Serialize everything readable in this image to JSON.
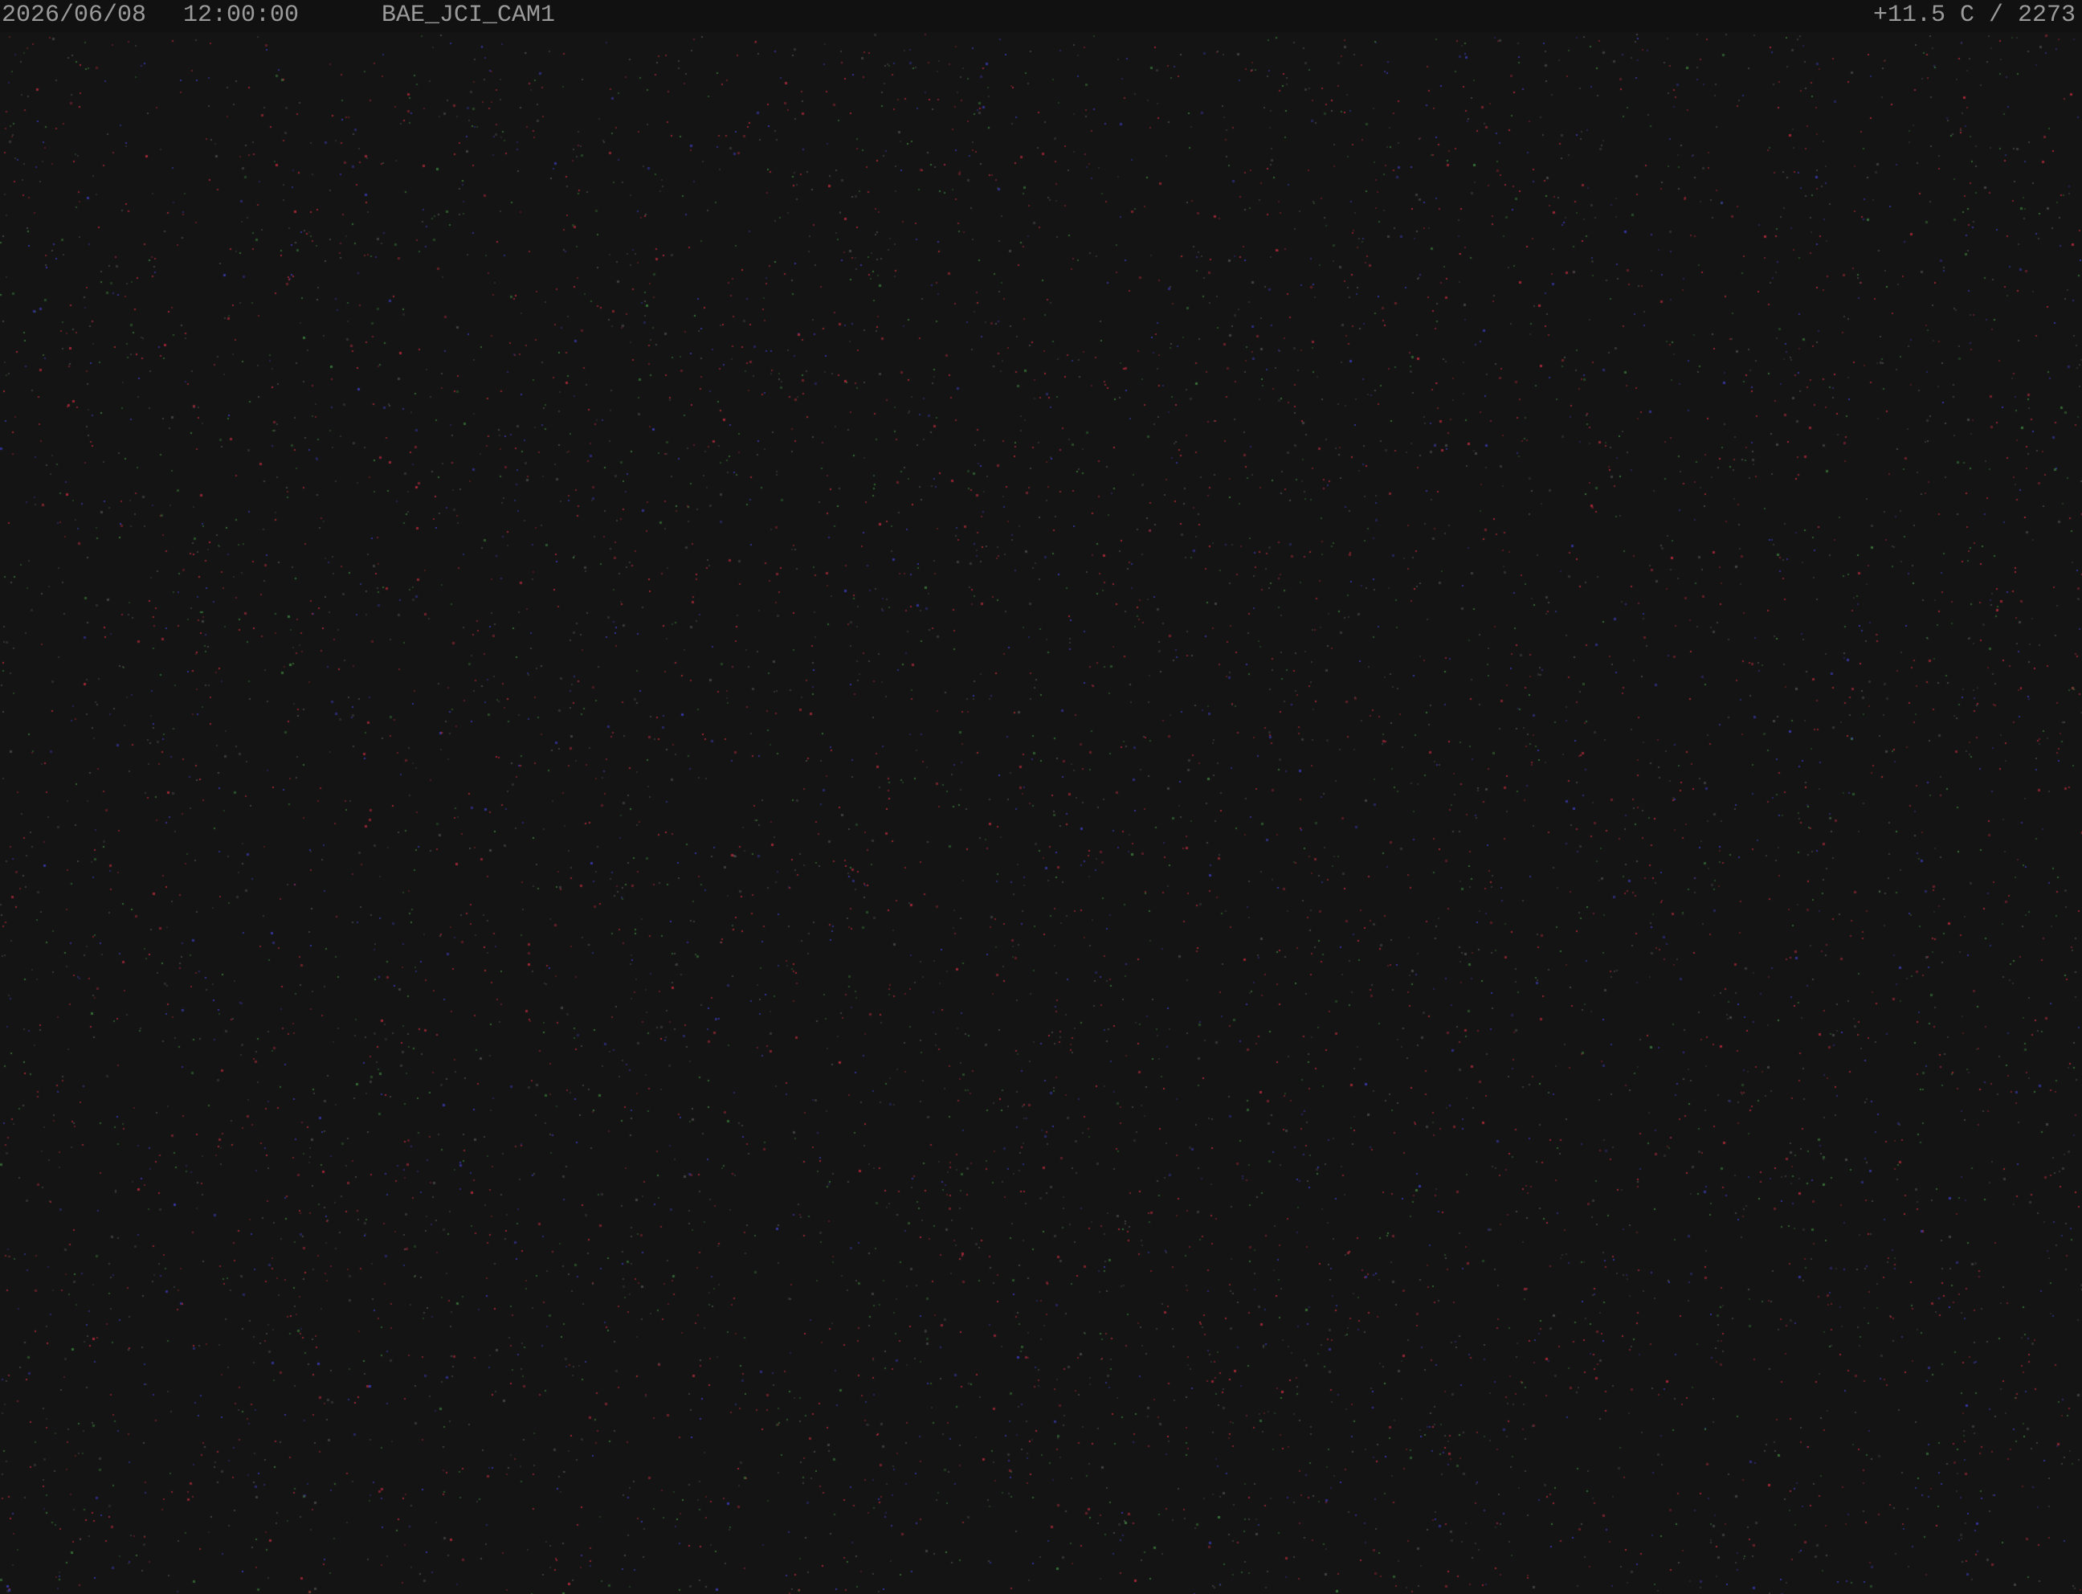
{
  "overlay": {
    "date": "2026/06/08",
    "time": "12:00:00",
    "camera_id": "BAE_JCI_CAM1",
    "temperature_readout": "+11.5 C / 2273"
  },
  "colors": {
    "background": "#141414",
    "overlay_bar": "#111111",
    "overlay_text": "#9a9a9a",
    "noise_red": "#b02a3a",
    "noise_blue": "#3a3ab0",
    "noise_green": "#3a7a3a",
    "noise_grey": "#4a4a4a"
  }
}
